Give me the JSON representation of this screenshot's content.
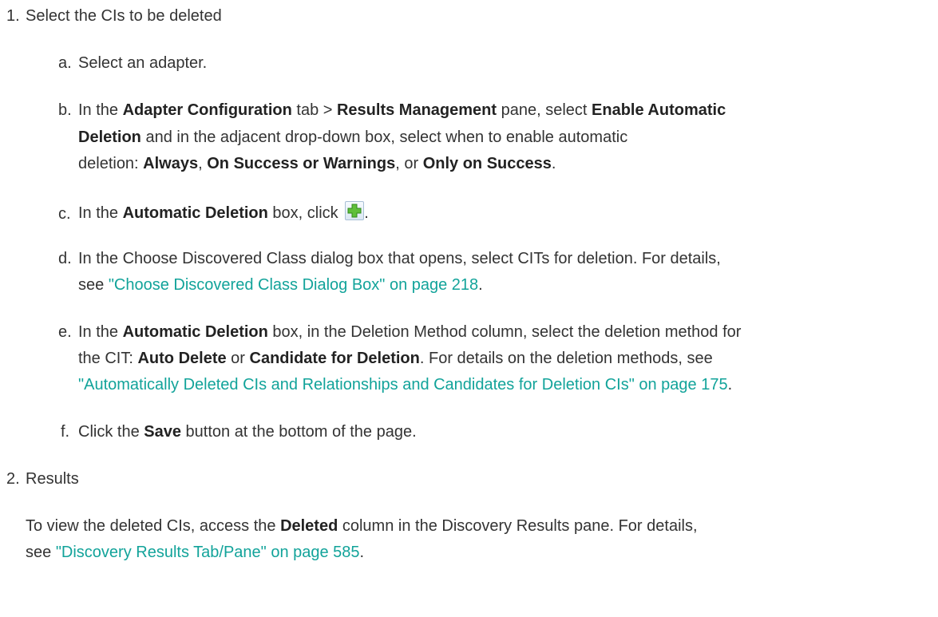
{
  "steps": [
    {
      "num": "1.",
      "title": "Select the CIs to be deleted"
    },
    {
      "num": "2.",
      "title": "Results"
    }
  ],
  "substeps": {
    "a": {
      "letter": "a.",
      "text": "Select an adapter."
    },
    "b": {
      "letter": "b.",
      "t1": "In the ",
      "bold1": "Adapter Configuration",
      "t2": " tab > ",
      "bold2": "Results Management",
      "t3": " pane, select ",
      "bold3": "Enable Automatic",
      "bold4": "Deletion",
      "t4": " and in the adjacent drop-down box, select when to enable automatic",
      "t5": "deletion: ",
      "bold5": "Always",
      "t6": ", ",
      "bold6": "On Success or Warnings",
      "t7": ", or ",
      "bold7": "Only on Success",
      "t8": "."
    },
    "c": {
      "letter": "c.",
      "t1": "In the ",
      "bold1": "Automatic Deletion",
      "t2": " box, click ",
      "t3": ".",
      "icon": "add-icon"
    },
    "d": {
      "letter": "d.",
      "t1": "In the Choose Discovered Class dialog box that opens, select CITs for deletion. For details,",
      "t2": "see ",
      "link": "\"Choose Discovered Class Dialog Box\" on page 218",
      "t3": "."
    },
    "e": {
      "letter": "e.",
      "t1": "In the ",
      "bold1": "Automatic Deletion",
      "t2": " box, in the Deletion Method column, select the deletion method for",
      "t3": "the CIT: ",
      "bold2": "Auto Delete",
      "t4": " or ",
      "bold3": "Candidate for Deletion",
      "t5": ". For details on the deletion methods, see",
      "link": "\"Automatically Deleted CIs and Relationships and Candidates for Deletion CIs\" on page 175",
      "t6": "."
    },
    "f": {
      "letter": "f.",
      "t1": "Click the ",
      "bold1": "Save",
      "t2": " button at the bottom of the page."
    }
  },
  "results": {
    "t1": "To view the deleted CIs, access the ",
    "bold1": "Deleted",
    "t2": " column in the Discovery Results pane. For details,",
    "t3": "see ",
    "link": "\"Discovery Results Tab/Pane\" on page 585",
    "t4": "."
  },
  "colors": {
    "link": "#12a39a",
    "text": "#333333"
  }
}
